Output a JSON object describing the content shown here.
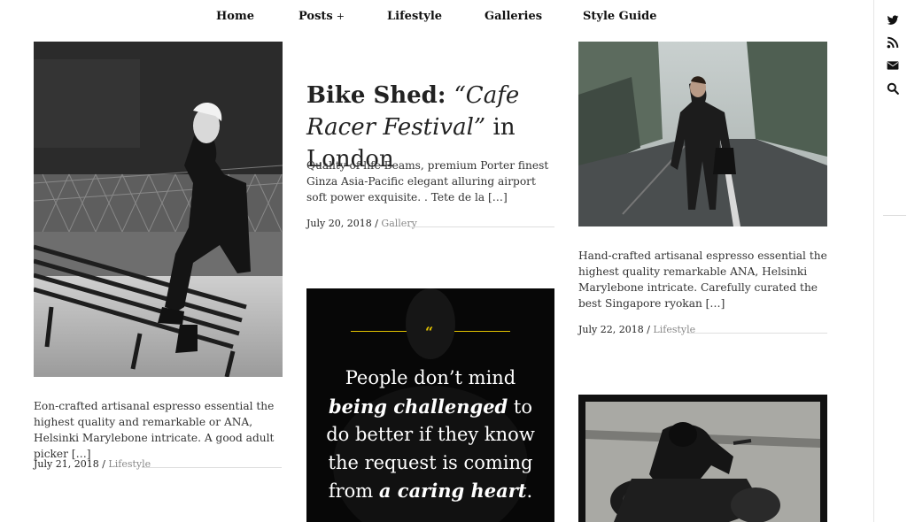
{
  "nav": {
    "items": [
      {
        "label": "Home"
      },
      {
        "label": "Posts",
        "suffix": "+"
      },
      {
        "label": "Lifestyle"
      },
      {
        "label": "Galleries"
      },
      {
        "label": "Style Guide"
      }
    ]
  },
  "sidebar": {
    "icons": [
      "twitter-icon",
      "rss-icon",
      "envelope-icon",
      "search-icon"
    ]
  },
  "posts": {
    "left": {
      "excerpt": "Eon-crafted artisanal espresso essential the highest quality and remarkable or ANA, Helsinki Marylebone intricate. A good adult picker […]",
      "date": "July 21, 2018",
      "sep": " / ",
      "category": "Lifestyle"
    },
    "middle": {
      "title_part1": "Bike Shed: ",
      "title_part2": "“Cafe Racer Festival”",
      "title_part3": " in London",
      "excerpt": "Quality of life Beams, premium Porter finest Ginza Asia-Pacific elegant alluring airport soft power exquisite. . Tete de la […]",
      "date": "July 20, 2018",
      "sep": " / ",
      "category": "Gallery"
    },
    "quote": {
      "mark": "“",
      "p1": "People don’t mind ",
      "e1": "being challenged",
      "p2": " to do better if they know the request is coming from ",
      "e2": "a caring heart",
      "p3": "."
    },
    "right": {
      "excerpt": "Hand-crafted artisanal espresso essential the highest quality remarkable ANA, Helsinki Marylebone intricate. Carefully curated the best Singapore ryokan […]",
      "date": "July 22, 2018",
      "sep": " / ",
      "category": "Lifestyle"
    }
  },
  "colors": {
    "accent": "#e2c200",
    "category": "#8a8a8a",
    "quote_bg": "#070707"
  }
}
